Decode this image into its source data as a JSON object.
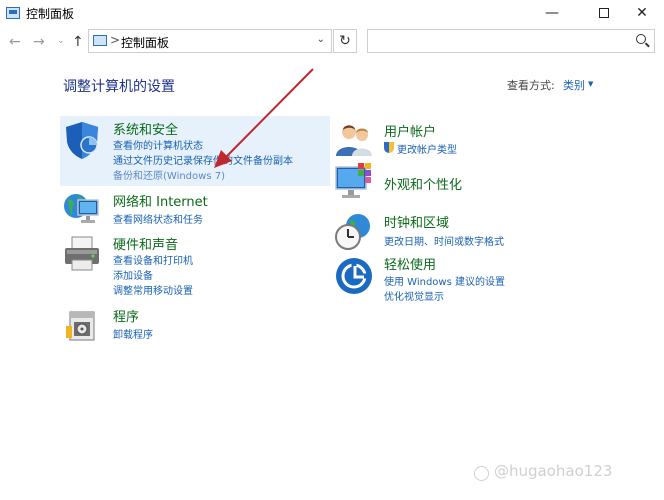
{
  "window": {
    "title": "控制面板",
    "minimize_glyph": "—",
    "close_glyph": "✕"
  },
  "nav": {
    "back_glyph": "←",
    "forward_glyph": "→",
    "history_glyph": "⌄",
    "up_glyph": "↑",
    "address_separator": ">",
    "address_text": "控制面板",
    "address_dropdown_glyph": "⌄",
    "refresh_glyph": "↻",
    "search_placeholder": ""
  },
  "header": {
    "heading": "调整计算机的设置",
    "view_by_label": "查看方式:",
    "view_by_value": "类别",
    "view_by_dropdown_glyph": "▼"
  },
  "categories_left": [
    {
      "icon": "security-shield-icon",
      "title": "系统和安全",
      "links": [
        "查看你的计算机状态",
        "通过文件历史记录保存你的文件备份副本",
        "备份和还原(Windows 7)"
      ]
    },
    {
      "icon": "network-globe-icon",
      "title": "网络和 Internet",
      "links": [
        "查看网络状态和任务"
      ]
    },
    {
      "icon": "printer-icon",
      "title": "硬件和声音",
      "links": [
        "查看设备和打印机",
        "添加设备",
        "调整常用移动设置"
      ]
    },
    {
      "icon": "programs-icon",
      "title": "程序",
      "links": [
        "卸载程序"
      ]
    }
  ],
  "categories_right": [
    {
      "icon": "user-accounts-icon",
      "title": "用户帐户",
      "links": [
        "更改帐户类型"
      ]
    },
    {
      "icon": "appearance-monitor-icon",
      "title": "外观和个性化",
      "links": []
    },
    {
      "icon": "clock-globe-icon",
      "title": "时钟和区域",
      "links": [
        "更改日期、时间或数字格式"
      ]
    },
    {
      "icon": "ease-of-access-icon",
      "title": "轻松使用",
      "links": [
        "使用 Windows 建议的设置",
        "优化视觉显示"
      ]
    }
  ],
  "watermark": {
    "text": "@hugaohao123"
  },
  "colors": {
    "category_title": "#0b6a1a",
    "link": "#1a62b3",
    "heading": "#1e3287",
    "highlight": "#e6f1fb",
    "annotation_arrow": "#c0282e"
  }
}
